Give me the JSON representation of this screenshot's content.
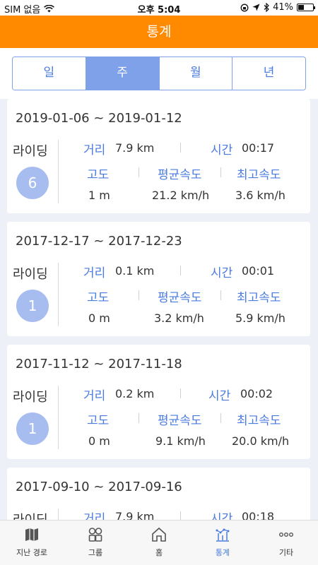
{
  "status": {
    "carrier": "SIM 없음",
    "time": "오후 5:04",
    "battery": "41%",
    "battery_level": 0.41
  },
  "header": {
    "title": "통계"
  },
  "segments": [
    {
      "label": "일",
      "active": false
    },
    {
      "label": "주",
      "active": true
    },
    {
      "label": "월",
      "active": false
    },
    {
      "label": "년",
      "active": false
    }
  ],
  "labels": {
    "riding": "라이딩",
    "distance": "거리",
    "time": "시간",
    "altitude": "고도",
    "avg_speed": "평균속도",
    "max_speed": "최고속도"
  },
  "weeks": [
    {
      "range": "2019-01-06 ~ 2019-01-12",
      "rides": "6",
      "distance": "7.9 km",
      "time": "00:17",
      "altitude": "1 m",
      "avg_speed": "21.2 km/h",
      "max_speed": "3.6 km/h"
    },
    {
      "range": "2017-12-17 ~ 2017-12-23",
      "rides": "1",
      "distance": "0.1 km",
      "time": "00:01",
      "altitude": "0 m",
      "avg_speed": "3.2 km/h",
      "max_speed": "5.9 km/h"
    },
    {
      "range": "2017-11-12 ~ 2017-11-18",
      "rides": "1",
      "distance": "0.2 km",
      "time": "00:02",
      "altitude": "0 m",
      "avg_speed": "9.1 km/h",
      "max_speed": "20.0 km/h"
    },
    {
      "range": "2017-09-10 ~ 2017-09-16",
      "rides": "",
      "distance": "7.9 km",
      "time": "00:18",
      "altitude": "",
      "avg_speed": "",
      "max_speed": ""
    }
  ],
  "tabs": [
    {
      "label": "지난 경로",
      "icon": "map-icon",
      "active": false
    },
    {
      "label": "그룹",
      "icon": "group-icon",
      "active": false
    },
    {
      "label": "홈",
      "icon": "home-icon",
      "active": false
    },
    {
      "label": "통계",
      "icon": "stats-icon",
      "active": true
    },
    {
      "label": "기타",
      "icon": "more-icon",
      "active": false
    }
  ]
}
